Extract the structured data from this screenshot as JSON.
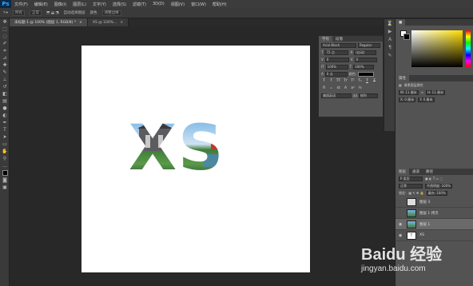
{
  "app": {
    "logo": "Ps"
  },
  "menu": [
    "文件(F)",
    "编辑(E)",
    "图像(I)",
    "图层(L)",
    "文字(Y)",
    "选择(S)",
    "滤镜(T)",
    "3D(D)",
    "视图(V)",
    "窗口(W)",
    "帮助(H)"
  ],
  "options": {
    "sample": "所有",
    "style": "正常",
    "auto_select": "自动选择图层",
    "color_label": "颜色",
    "refine": "调整边缘"
  },
  "tabs": [
    {
      "label": "未标题-1 @ 100% (图层 1, RGB/8) *"
    },
    {
      "label": "XS @ 100%..."
    }
  ],
  "character": {
    "tab1": "字符",
    "tab2": "段落",
    "font": "Arial Black",
    "style": "Regular",
    "size": "72 点",
    "leading": "(自动)",
    "tracking": "0",
    "kerning": "0",
    "scale_v": "100%",
    "scale_h": "100%",
    "baseline": "0 点",
    "color_label": "颜色:",
    "lang": "美国英语",
    "aa": "锐利"
  },
  "properties": {
    "title": "属性",
    "item": "像素图层属性",
    "w": "W: 11 厘米",
    "h": "H: 11 厘米",
    "x": "X: 0 厘米",
    "y": "Y: 0 厘米"
  },
  "layers": {
    "tabs": [
      "图层",
      "通道",
      "路径"
    ],
    "kind": "P 类型",
    "blend": "正常",
    "opacity": "不透明度: 100%",
    "lock": "锁定:",
    "fill": "填充: 100%",
    "items": [
      {
        "name": "图层 3",
        "visible": false,
        "selected": false
      },
      {
        "name": "图层 1 拷贝",
        "visible": false,
        "selected": false
      },
      {
        "name": "图层 1",
        "visible": true,
        "selected": true
      },
      {
        "name": "XS",
        "visible": true,
        "selected": false
      }
    ]
  },
  "watermark": {
    "brand": "Baidu 经验",
    "url": "jingyan.baidu.com"
  },
  "canvas_text": "XS",
  "colors": {
    "accent": "#31a8ff",
    "panel": "#535353",
    "bg": "#282828"
  }
}
